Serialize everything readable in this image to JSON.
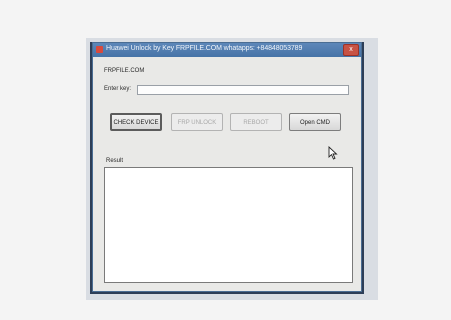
{
  "window": {
    "title": "Huawei Unlock by Key FRPFILE.COM whatapps: +84848053789",
    "close_glyph": "x"
  },
  "brand_label": "FRPFILE.COM",
  "key_field": {
    "label": "Enter key:",
    "value": ""
  },
  "buttons": {
    "check_device": "CHECK DEVICE",
    "frp_unlock": "FRP UNLOCK",
    "reboot": "REBOOT",
    "open_cmd": "Open CMD"
  },
  "result": {
    "label": "Result",
    "text": ""
  }
}
